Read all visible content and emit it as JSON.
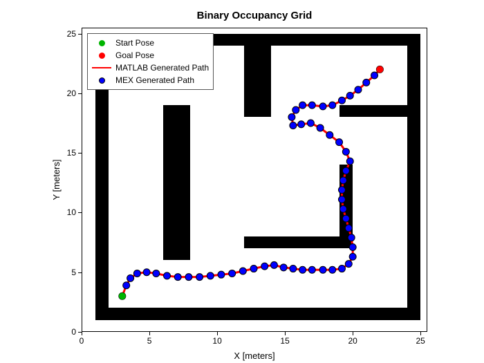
{
  "chart_data": {
    "type": "scatter",
    "title": "Binary Occupancy Grid",
    "xlabel": "X [meters]",
    "ylabel": "Y [meters]",
    "xlim": [
      0,
      25.5
    ],
    "ylim": [
      0,
      25.5
    ],
    "xticks": [
      0,
      5,
      10,
      15,
      20,
      25
    ],
    "yticks": [
      0,
      5,
      10,
      15,
      20,
      25
    ],
    "legend": {
      "position": "upper-left",
      "entries": [
        {
          "label": "Start Pose",
          "marker": "dot",
          "color": "#00b400"
        },
        {
          "label": "Goal Pose",
          "marker": "dot",
          "color": "#ff0000"
        },
        {
          "label": "MATLAB Generated Path",
          "marker": "line",
          "color": "#ff0000"
        },
        {
          "label": "MEX Generated Path",
          "marker": "dot",
          "color": "#0000ff",
          "edge": "#000"
        }
      ]
    },
    "obstacles_rects_xywh": [
      [
        1,
        1,
        24,
        1
      ],
      [
        1,
        1,
        1,
        24
      ],
      [
        1,
        24,
        24,
        1
      ],
      [
        24,
        1,
        1,
        24
      ],
      [
        6,
        6,
        2,
        13
      ],
      [
        12,
        18,
        2,
        6
      ],
      [
        12,
        7,
        8,
        1
      ],
      [
        19,
        7,
        1,
        7
      ],
      [
        19,
        18,
        6,
        1
      ]
    ],
    "start_pose": {
      "x": 3.0,
      "y": 3.0
    },
    "goal_pose": {
      "x": 22.0,
      "y": 22.0
    },
    "series": [
      {
        "name": "MATLAB Generated Path",
        "style": "line",
        "color": "#ff0000",
        "x": [
          3.0,
          3.3,
          3.6,
          4.1,
          4.8,
          5.5,
          6.3,
          7.1,
          7.9,
          8.7,
          9.5,
          10.3,
          11.1,
          11.9,
          12.7,
          13.5,
          14.2,
          14.9,
          15.6,
          16.3,
          17.0,
          17.8,
          18.5,
          19.2,
          19.7,
          20.0,
          20.0,
          19.9,
          19.7,
          19.5,
          19.3,
          19.2,
          19.2,
          19.3,
          19.5,
          19.8,
          19.5,
          19.0,
          18.3,
          17.6,
          16.9,
          16.2,
          15.6,
          15.5,
          15.8,
          16.3,
          17.0,
          17.8,
          18.5,
          19.2,
          19.8,
          20.4,
          21.0,
          21.6,
          22.0
        ],
        "y": [
          3.0,
          3.9,
          4.5,
          4.9,
          5.0,
          4.9,
          4.7,
          4.6,
          4.6,
          4.6,
          4.7,
          4.8,
          4.9,
          5.1,
          5.3,
          5.5,
          5.6,
          5.4,
          5.3,
          5.2,
          5.2,
          5.2,
          5.2,
          5.3,
          5.7,
          6.3,
          7.1,
          7.9,
          8.7,
          9.5,
          10.3,
          11.1,
          11.9,
          12.7,
          13.5,
          14.3,
          15.1,
          15.9,
          16.5,
          17.1,
          17.5,
          17.4,
          17.3,
          18.0,
          18.6,
          19.0,
          19.0,
          18.9,
          19.0,
          19.4,
          19.8,
          20.3,
          20.9,
          21.5,
          22.0
        ]
      },
      {
        "name": "MEX Generated Path",
        "style": "markers",
        "color": "#0000ff",
        "edge": "#000000",
        "x": [
          3.0,
          3.3,
          3.6,
          4.1,
          4.8,
          5.5,
          6.3,
          7.1,
          7.9,
          8.7,
          9.5,
          10.3,
          11.1,
          11.9,
          12.7,
          13.5,
          14.2,
          14.9,
          15.6,
          16.3,
          17.0,
          17.8,
          18.5,
          19.2,
          19.7,
          20.0,
          20.0,
          19.9,
          19.7,
          19.5,
          19.3,
          19.2,
          19.2,
          19.3,
          19.5,
          19.8,
          19.5,
          19.0,
          18.3,
          17.6,
          16.9,
          16.2,
          15.6,
          15.5,
          15.8,
          16.3,
          17.0,
          17.8,
          18.5,
          19.2,
          19.8,
          20.4,
          21.0,
          21.6,
          22.0
        ],
        "y": [
          3.0,
          3.9,
          4.5,
          4.9,
          5.0,
          4.9,
          4.7,
          4.6,
          4.6,
          4.6,
          4.7,
          4.8,
          4.9,
          5.1,
          5.3,
          5.5,
          5.6,
          5.4,
          5.3,
          5.2,
          5.2,
          5.2,
          5.2,
          5.3,
          5.7,
          6.3,
          7.1,
          7.9,
          8.7,
          9.5,
          10.3,
          11.1,
          11.9,
          12.7,
          13.5,
          14.3,
          15.1,
          15.9,
          16.5,
          17.1,
          17.5,
          17.4,
          17.3,
          18.0,
          18.6,
          19.0,
          19.0,
          18.9,
          19.0,
          19.4,
          19.8,
          20.3,
          20.9,
          21.5,
          22.0
        ]
      }
    ]
  }
}
